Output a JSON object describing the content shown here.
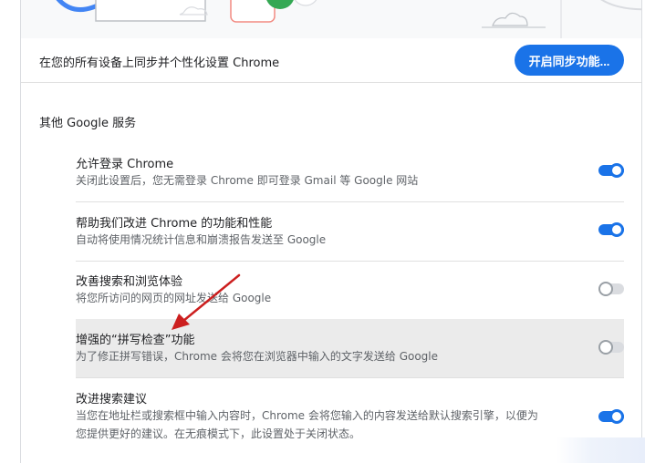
{
  "sync": {
    "text": "在您的所有设备上同步并个性化设置 Chrome",
    "button_label": "开启同步功能..."
  },
  "section": {
    "title": "其他 Google 服务"
  },
  "settings": [
    {
      "title": "允许登录 Chrome",
      "desc": "关闭此设置后，您无需登录 Chrome 即可登录 Gmail 等 Google 网站",
      "enabled": true
    },
    {
      "title": "帮助我们改进 Chrome 的功能和性能",
      "desc": "自动将使用情况统计信息和崩溃报告发送至 Google",
      "enabled": true
    },
    {
      "title": "改善搜索和浏览体验",
      "desc": "将您所访问的网页的网址发送给 Google",
      "enabled": false
    },
    {
      "title": "增强的“拼写检查”功能",
      "desc": "为了修正拼写错误，Chrome 会将您在浏览器中输入的文字发送给 Google",
      "enabled": false
    },
    {
      "title": "改进搜索建议",
      "desc": "当您在地址栏或搜索框中输入内容时，Chrome 会将您输入的内容发送给默认搜索引擎，以便为",
      "desc2": "您提供更好的建议。在无痕模式下，此设置处于关闭状态。",
      "enabled": true
    }
  ],
  "colors": {
    "accent": "#1a73e8",
    "annotation_arrow": "#cc1f1f",
    "highlight_row": "#ebebeb"
  }
}
